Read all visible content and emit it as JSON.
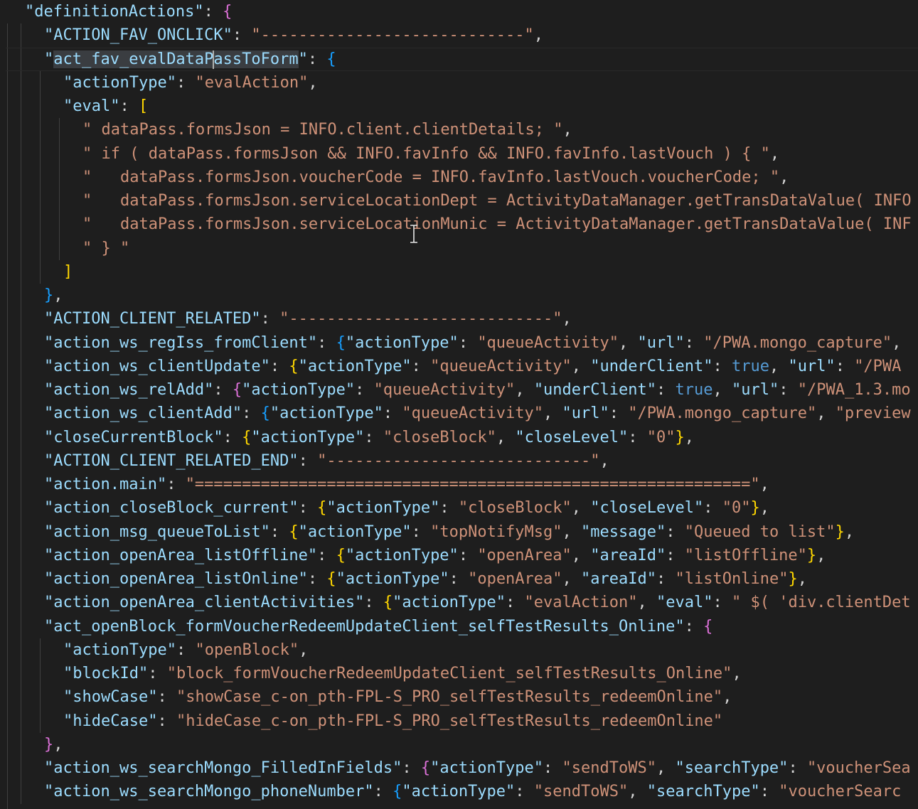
{
  "editor": {
    "lines": [
      "\"definitionActions\": {",
      "\"ACTION_FAV_ONCLICK\": \"----------------------------\",",
      "\"act_fav_evalDataPassToForm\": {",
      "\"actionType\": \"evalAction\",",
      "\"eval\": [",
      "\" dataPass.formsJson = INFO.client.clientDetails; \",",
      "\" if ( dataPass.formsJson && INFO.favInfo && INFO.favInfo.lastVouch ) { \",",
      "\"   dataPass.formsJson.voucherCode = INFO.favInfo.lastVouch.voucherCode; \",",
      "\"   dataPass.formsJson.serviceLocationDept = ActivityDataManager.getTransDataValue( INFO",
      "\"   dataPass.formsJson.serviceLocationMunic = ActivityDataManager.getTransDataValue( INF",
      "\" } \"",
      "]",
      "},",
      "\"ACTION_CLIENT_RELATED\": \"----------------------------\",",
      "\"action_ws_regIss_fromClient\": {\"actionType\": \"queueActivity\", \"url\": \"/PWA.mongo_capture\",",
      "\"action_ws_clientUpdate\": {\"actionType\": \"queueActivity\", \"underClient\": true, \"url\": \"/PWA",
      "\"action_ws_relAdd\": {\"actionType\": \"queueActivity\", \"underClient\": true, \"url\": \"/PWA_1.3.mo",
      "\"action_ws_clientAdd\": {\"actionType\": \"queueActivity\", \"url\": \"/PWA.mongo_capture\", \"preview",
      "\"closeCurrentBlock\": {\"actionType\": \"closeBlock\", \"closeLevel\": \"0\"},",
      "\"ACTION_CLIENT_RELATED_END\": \"----------------------------\",",
      "\"action.main\": \"===========================================================\",",
      "\"action_closeBlock_current\": {\"actionType\": \"closeBlock\", \"closeLevel\": \"0\"},",
      "\"action_msg_queueToList\": {\"actionType\": \"topNotifyMsg\", \"message\": \"Queued to list\"},",
      "\"action_openArea_listOffline\": {\"actionType\": \"openArea\", \"areaId\": \"listOffline\"},",
      "\"action_openArea_listOnline\": {\"actionType\": \"openArea\", \"areaId\": \"listOnline\"},",
      "\"action_openArea_clientActivities\": {\"actionType\": \"evalAction\", \"eval\": \" $( 'div.clientDet",
      "\"act_openBlock_formVoucherRedeemUpdateClient_selfTestResults_Online\": {",
      "\"actionType\": \"openBlock\",",
      "\"blockId\": \"block_formVoucherRedeemUpdateClient_selfTestResults_Online\",",
      "\"showCase\": \"showCase_c-on_pth-FPL-S_PRO_selfTestResults_redeemOnline\",",
      "\"hideCase\": \"hideCase_c-on_pth-FPL-S_PRO_selfTestResults_redeemOnline\"",
      "},",
      "\"action_ws_searchMongo_FilledInFields\": {\"actionType\": \"sendToWS\", \"searchType\": \"voucherSea",
      "\"action_ws_searchMongo_phoneNumber\": {\"actionType\": \"sendToWS\", \"searchType\": \"voucherSearc"
    ],
    "indents": [
      1,
      2,
      2,
      3,
      3,
      4,
      4,
      4,
      4,
      4,
      4,
      3,
      2,
      2,
      2,
      2,
      2,
      2,
      2,
      2,
      2,
      2,
      2,
      2,
      2,
      2,
      2,
      3,
      3,
      3,
      3,
      2,
      2,
      2
    ],
    "selected_token": "act_fav_evalDataPassToForm",
    "cursor_line": 2,
    "colors": {
      "background": "#1e1e1e",
      "key": "#9cdcfe",
      "string": "#ce9178",
      "punctuation": "#d4d4d4",
      "boolean": "#569cd6",
      "bracket_level1": "#da70d6",
      "bracket_level2": "#179fff",
      "bracket_level3": "#ffd700",
      "indent_guide": "#404040",
      "selection": "#3a3d41"
    }
  }
}
